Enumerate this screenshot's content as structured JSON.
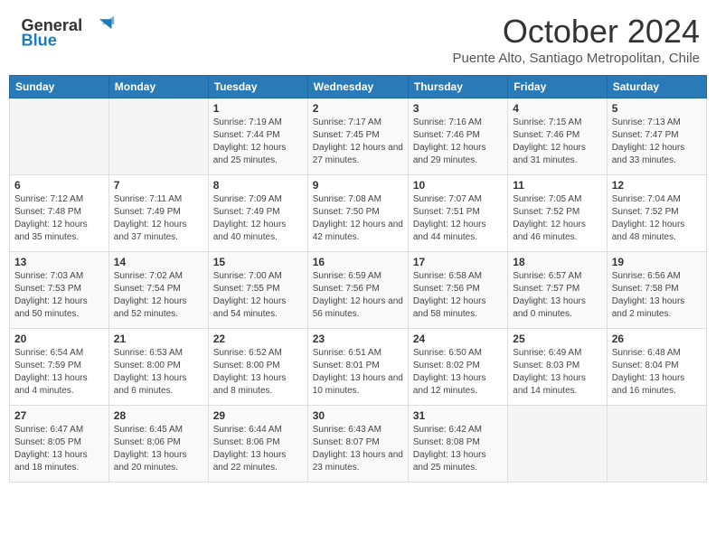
{
  "header": {
    "logo_general": "General",
    "logo_blue": "Blue",
    "month_title": "October 2024",
    "subtitle": "Puente Alto, Santiago Metropolitan, Chile"
  },
  "weekdays": [
    "Sunday",
    "Monday",
    "Tuesday",
    "Wednesday",
    "Thursday",
    "Friday",
    "Saturday"
  ],
  "weeks": [
    [
      {
        "day": "",
        "info": ""
      },
      {
        "day": "",
        "info": ""
      },
      {
        "day": "1",
        "info": "Sunrise: 7:19 AM\nSunset: 7:44 PM\nDaylight: 12 hours and 25 minutes."
      },
      {
        "day": "2",
        "info": "Sunrise: 7:17 AM\nSunset: 7:45 PM\nDaylight: 12 hours and 27 minutes."
      },
      {
        "day": "3",
        "info": "Sunrise: 7:16 AM\nSunset: 7:46 PM\nDaylight: 12 hours and 29 minutes."
      },
      {
        "day": "4",
        "info": "Sunrise: 7:15 AM\nSunset: 7:46 PM\nDaylight: 12 hours and 31 minutes."
      },
      {
        "day": "5",
        "info": "Sunrise: 7:13 AM\nSunset: 7:47 PM\nDaylight: 12 hours and 33 minutes."
      }
    ],
    [
      {
        "day": "6",
        "info": "Sunrise: 7:12 AM\nSunset: 7:48 PM\nDaylight: 12 hours and 35 minutes."
      },
      {
        "day": "7",
        "info": "Sunrise: 7:11 AM\nSunset: 7:49 PM\nDaylight: 12 hours and 37 minutes."
      },
      {
        "day": "8",
        "info": "Sunrise: 7:09 AM\nSunset: 7:49 PM\nDaylight: 12 hours and 40 minutes."
      },
      {
        "day": "9",
        "info": "Sunrise: 7:08 AM\nSunset: 7:50 PM\nDaylight: 12 hours and 42 minutes."
      },
      {
        "day": "10",
        "info": "Sunrise: 7:07 AM\nSunset: 7:51 PM\nDaylight: 12 hours and 44 minutes."
      },
      {
        "day": "11",
        "info": "Sunrise: 7:05 AM\nSunset: 7:52 PM\nDaylight: 12 hours and 46 minutes."
      },
      {
        "day": "12",
        "info": "Sunrise: 7:04 AM\nSunset: 7:52 PM\nDaylight: 12 hours and 48 minutes."
      }
    ],
    [
      {
        "day": "13",
        "info": "Sunrise: 7:03 AM\nSunset: 7:53 PM\nDaylight: 12 hours and 50 minutes."
      },
      {
        "day": "14",
        "info": "Sunrise: 7:02 AM\nSunset: 7:54 PM\nDaylight: 12 hours and 52 minutes."
      },
      {
        "day": "15",
        "info": "Sunrise: 7:00 AM\nSunset: 7:55 PM\nDaylight: 12 hours and 54 minutes."
      },
      {
        "day": "16",
        "info": "Sunrise: 6:59 AM\nSunset: 7:56 PM\nDaylight: 12 hours and 56 minutes."
      },
      {
        "day": "17",
        "info": "Sunrise: 6:58 AM\nSunset: 7:56 PM\nDaylight: 12 hours and 58 minutes."
      },
      {
        "day": "18",
        "info": "Sunrise: 6:57 AM\nSunset: 7:57 PM\nDaylight: 13 hours and 0 minutes."
      },
      {
        "day": "19",
        "info": "Sunrise: 6:56 AM\nSunset: 7:58 PM\nDaylight: 13 hours and 2 minutes."
      }
    ],
    [
      {
        "day": "20",
        "info": "Sunrise: 6:54 AM\nSunset: 7:59 PM\nDaylight: 13 hours and 4 minutes."
      },
      {
        "day": "21",
        "info": "Sunrise: 6:53 AM\nSunset: 8:00 PM\nDaylight: 13 hours and 6 minutes."
      },
      {
        "day": "22",
        "info": "Sunrise: 6:52 AM\nSunset: 8:00 PM\nDaylight: 13 hours and 8 minutes."
      },
      {
        "day": "23",
        "info": "Sunrise: 6:51 AM\nSunset: 8:01 PM\nDaylight: 13 hours and 10 minutes."
      },
      {
        "day": "24",
        "info": "Sunrise: 6:50 AM\nSunset: 8:02 PM\nDaylight: 13 hours and 12 minutes."
      },
      {
        "day": "25",
        "info": "Sunrise: 6:49 AM\nSunset: 8:03 PM\nDaylight: 13 hours and 14 minutes."
      },
      {
        "day": "26",
        "info": "Sunrise: 6:48 AM\nSunset: 8:04 PM\nDaylight: 13 hours and 16 minutes."
      }
    ],
    [
      {
        "day": "27",
        "info": "Sunrise: 6:47 AM\nSunset: 8:05 PM\nDaylight: 13 hours and 18 minutes."
      },
      {
        "day": "28",
        "info": "Sunrise: 6:45 AM\nSunset: 8:06 PM\nDaylight: 13 hours and 20 minutes."
      },
      {
        "day": "29",
        "info": "Sunrise: 6:44 AM\nSunset: 8:06 PM\nDaylight: 13 hours and 22 minutes."
      },
      {
        "day": "30",
        "info": "Sunrise: 6:43 AM\nSunset: 8:07 PM\nDaylight: 13 hours and 23 minutes."
      },
      {
        "day": "31",
        "info": "Sunrise: 6:42 AM\nSunset: 8:08 PM\nDaylight: 13 hours and 25 minutes."
      },
      {
        "day": "",
        "info": ""
      },
      {
        "day": "",
        "info": ""
      }
    ]
  ]
}
